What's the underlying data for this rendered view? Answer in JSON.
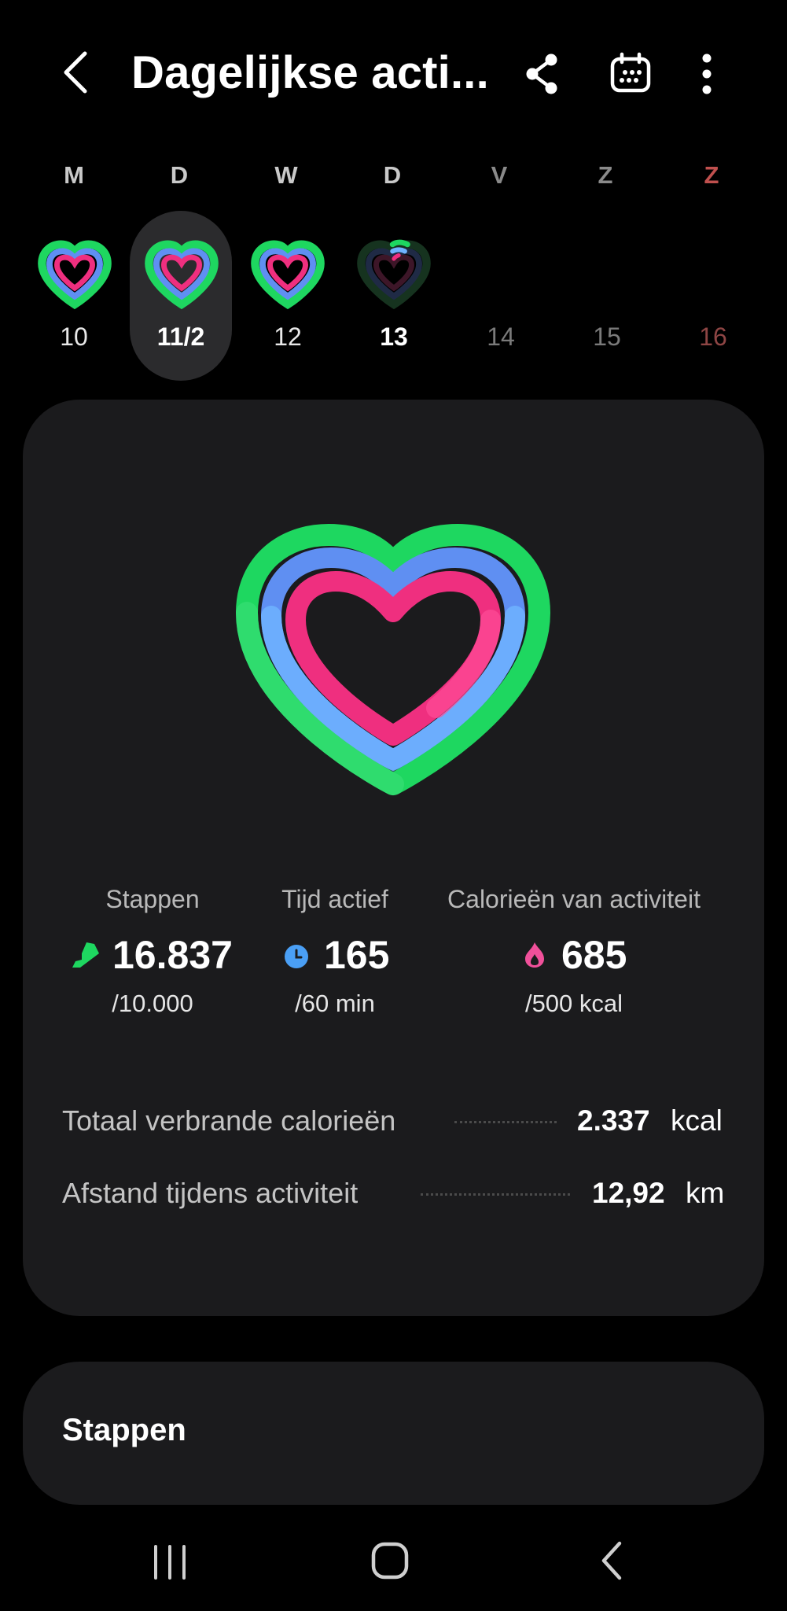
{
  "header": {
    "title": "Dagelijkse acti...",
    "icons": [
      "back-icon",
      "share-icon",
      "calendar-icon",
      "more-vert-icon"
    ]
  },
  "week": {
    "weekdays": [
      "M",
      "D",
      "W",
      "D",
      "V",
      "Z",
      "Z"
    ],
    "dates": [
      "10",
      "11/2",
      "12",
      "13",
      "14",
      "15",
      "16"
    ],
    "selected_index": 1,
    "today_index": 3
  },
  "stats": {
    "steps": {
      "label": "Stappen",
      "value": "16.837",
      "goal": "/10.000",
      "icon": "shoe-icon"
    },
    "active_time": {
      "label": "Tijd actief",
      "value": "165",
      "goal": "/60 min",
      "icon": "clock-icon"
    },
    "calories": {
      "label": "Calorieën van activiteit",
      "value": "685",
      "goal": "/500 kcal",
      "icon": "flame-icon"
    }
  },
  "details": [
    {
      "label": "Totaal verbrande calorieën",
      "value": "2.337",
      "unit": "kcal"
    },
    {
      "label": "Afstand tijdens activiteit",
      "value": "12,92",
      "unit": "km"
    }
  ],
  "steps_card": {
    "title": "Stappen"
  },
  "colors": {
    "green": "#1ed760",
    "blue": "#5f8ff2",
    "light_blue": "#6fb3ff",
    "pink": "#ef2f7f",
    "background": "#000000",
    "card": "#1b1b1d"
  },
  "nav": {
    "icons": [
      "recents-icon",
      "home-icon",
      "back-icon"
    ]
  }
}
